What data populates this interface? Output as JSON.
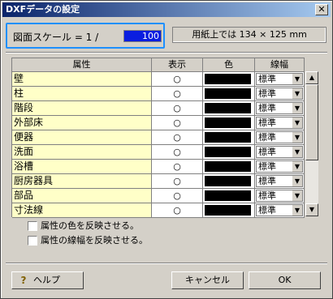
{
  "dialog": {
    "title": "DXFデータの設定",
    "close_glyph": "✕"
  },
  "scale": {
    "label": "図面スケール = 1 /",
    "value": "100"
  },
  "paper_info": "用紙上では 134 × 125 mm",
  "table": {
    "headers": {
      "attr": "属性",
      "show": "表示",
      "color": "色",
      "line": "線幅"
    },
    "rows": [
      {
        "attr": "壁",
        "show": "○",
        "line": "標準"
      },
      {
        "attr": "柱",
        "show": "○",
        "line": "標準"
      },
      {
        "attr": "階段",
        "show": "○",
        "line": "標準"
      },
      {
        "attr": "外部床",
        "show": "○",
        "line": "標準"
      },
      {
        "attr": "便器",
        "show": "○",
        "line": "標準"
      },
      {
        "attr": "洗面",
        "show": "○",
        "line": "標準"
      },
      {
        "attr": "浴槽",
        "show": "○",
        "line": "標準"
      },
      {
        "attr": "厨房器具",
        "show": "○",
        "line": "標準"
      },
      {
        "attr": "部品",
        "show": "○",
        "line": "標準"
      },
      {
        "attr": "寸法線",
        "show": "○",
        "line": "標準"
      }
    ],
    "row_color": "#000000"
  },
  "scroll": {
    "up_glyph": "▲",
    "down_glyph": "▼",
    "combo_glyph": "▼"
  },
  "options": {
    "reflect_color": "属性の色を反映させる。",
    "reflect_linewidth": "属性の線幅を反映させる。"
  },
  "buttons": {
    "help": "ヘルプ",
    "help_icon": "?",
    "cancel": "キャンセル",
    "ok": "OK"
  }
}
